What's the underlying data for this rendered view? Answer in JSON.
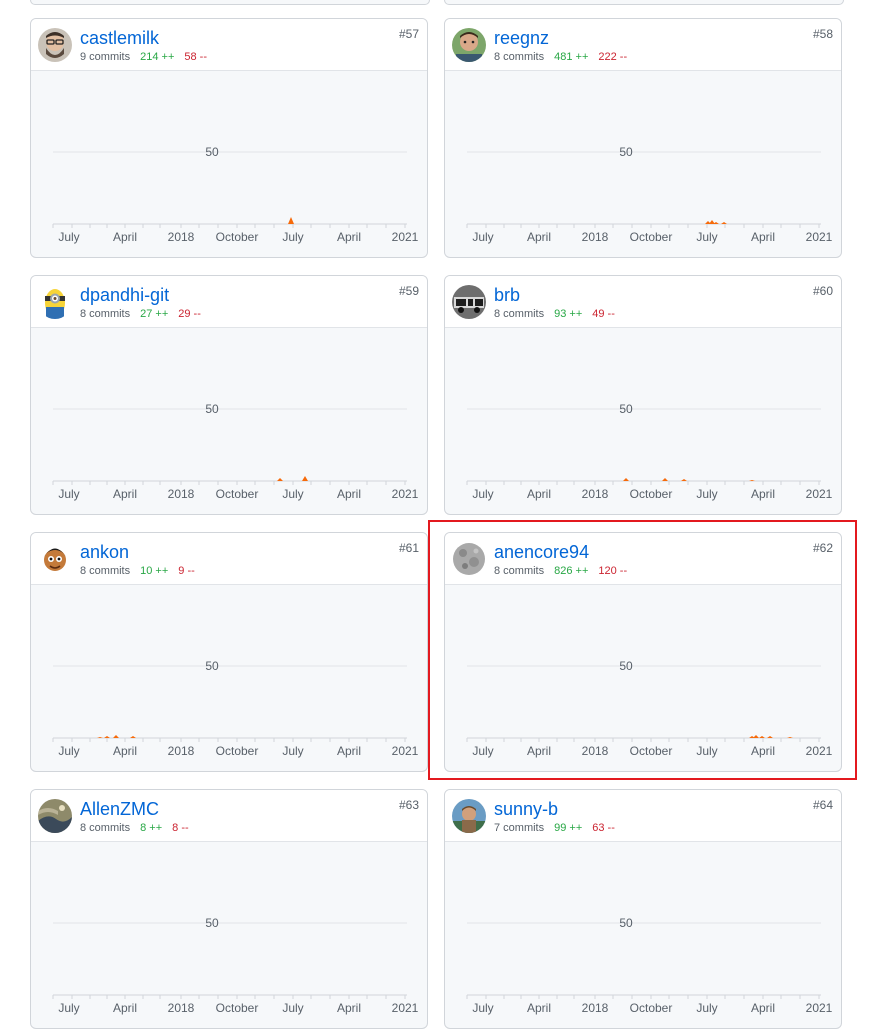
{
  "contributors": [
    {
      "login": "castlemilk",
      "commits": "9 commits",
      "additions": "214 ++",
      "deletions": "58 --",
      "rank": "#57",
      "avatar": "avatar-icon-bearded-man"
    },
    {
      "login": "reegnz",
      "commits": "8 commits",
      "additions": "481 ++",
      "deletions": "222 --",
      "rank": "#58",
      "avatar": "avatar-icon-man-portrait"
    },
    {
      "login": "dpandhi-git",
      "commits": "8 commits",
      "additions": "27 ++",
      "deletions": "29 --",
      "rank": "#59",
      "avatar": "avatar-icon-minion"
    },
    {
      "login": "brb",
      "commits": "8 commits",
      "additions": "93 ++",
      "deletions": "49 --",
      "rank": "#60",
      "avatar": "avatar-icon-truck"
    },
    {
      "login": "ankon",
      "commits": "8 commits",
      "additions": "10 ++",
      "deletions": "9 --",
      "rank": "#61",
      "avatar": "avatar-icon-cartoon-face"
    },
    {
      "login": "anencore94",
      "commits": "8 commits",
      "additions": "826 ++",
      "deletions": "120 --",
      "rank": "#62",
      "avatar": "avatar-icon-moon"
    },
    {
      "login": "AllenZMC",
      "commits": "8 commits",
      "additions": "8 ++",
      "deletions": "8 --",
      "rank": "#63",
      "avatar": "avatar-icon-landscape"
    },
    {
      "login": "sunny-b",
      "commits": "7 commits",
      "additions": "99 ++",
      "deletions": "63 --",
      "rank": "#64",
      "avatar": "avatar-icon-man-outdoors"
    }
  ],
  "chart_common": {
    "y_tick": "50",
    "x_ticks": [
      "July",
      "April",
      "2018",
      "October",
      "July",
      "April",
      "2021"
    ]
  },
  "colors": {
    "link": "#0366d6",
    "additions": "#28a745",
    "deletions": "#cb2431",
    "spike": "#f66a0a",
    "highlight": "#e3191f"
  }
}
